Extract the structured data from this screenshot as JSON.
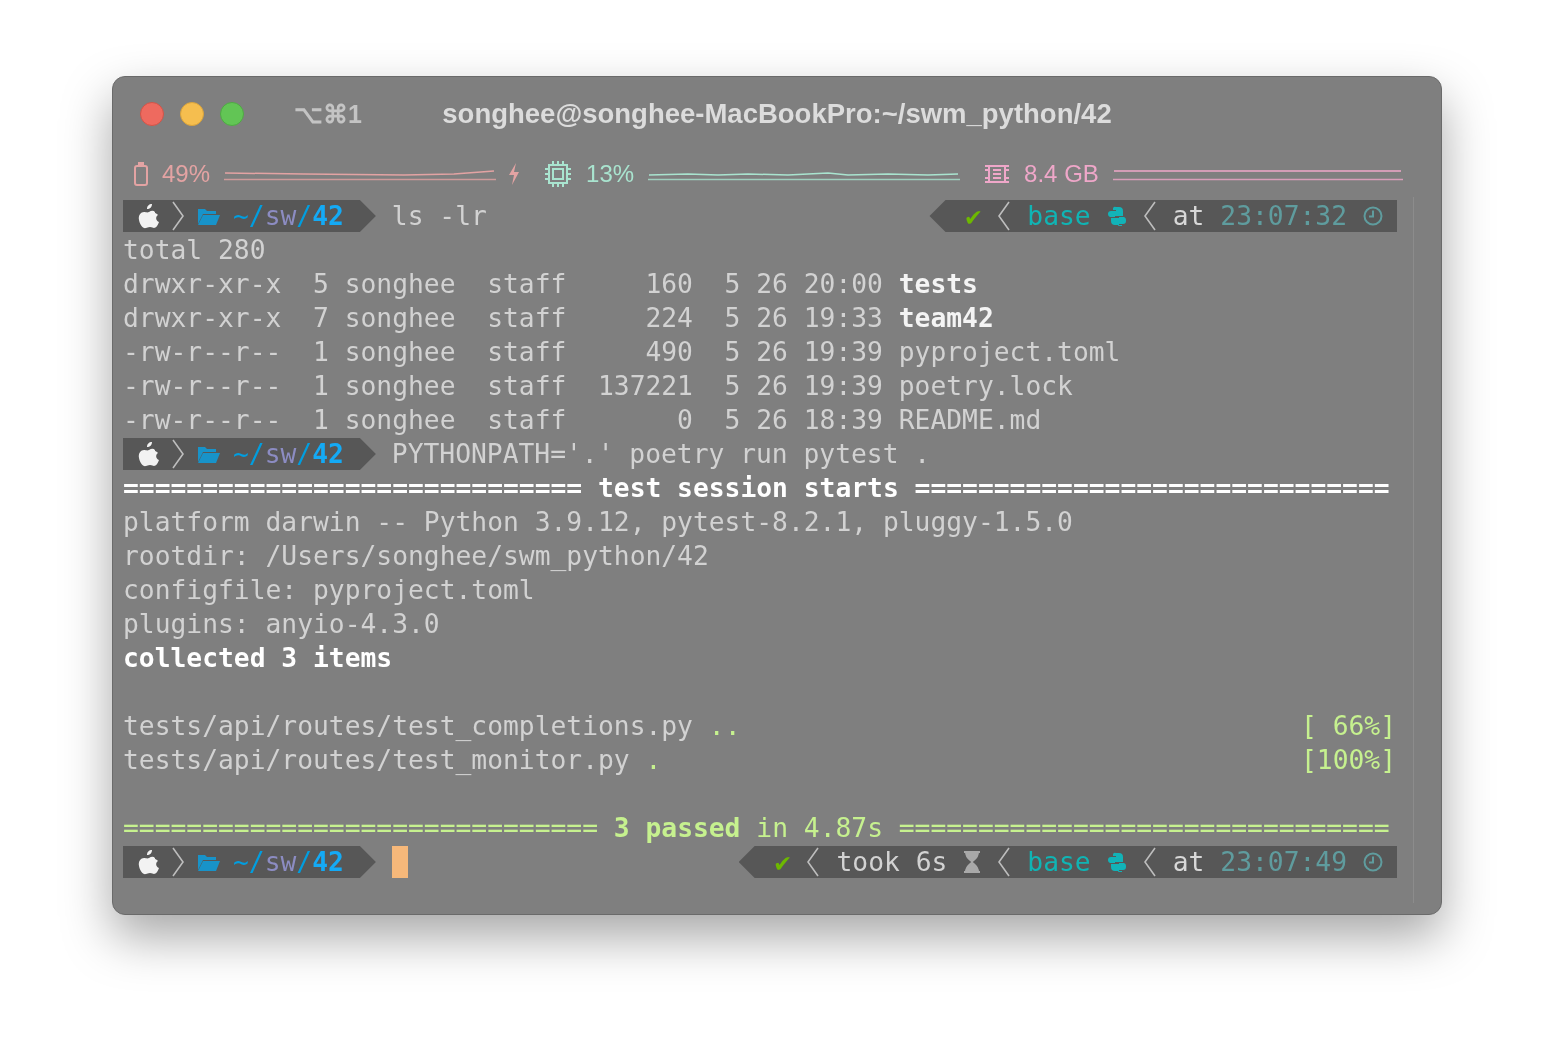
{
  "window": {
    "shortcut": "⌥⌘1",
    "title": "songhee@songhee-MacBookPro:~/swm_python/42"
  },
  "status_bar": [
    {
      "kind": "battery",
      "value": "49%",
      "color": "#e3a3a3"
    },
    {
      "kind": "cpu",
      "value": "13%",
      "color": "#a9e4cf"
    },
    {
      "kind": "memory",
      "value": "8.4 GB",
      "color": "#efa7c9"
    }
  ],
  "lines": [
    {
      "kind": "prompt",
      "path": [
        {
          "text": "~/",
          "kind": "home"
        },
        {
          "text": "sw",
          "kind": "dir"
        },
        {
          "text": "/",
          "kind": "sep"
        },
        {
          "text": "42",
          "kind": "current"
        }
      ],
      "command": "ls -lr",
      "right": [
        {
          "kind": "status",
          "text": "✔"
        },
        {
          "kind": "env",
          "text": "base"
        },
        {
          "kind": "time",
          "label": "at",
          "text": "23:07:32"
        }
      ]
    },
    {
      "kind": "output",
      "segments": [
        {
          "text": "total 280",
          "kind": "plain"
        }
      ]
    },
    {
      "kind": "output",
      "segments": [
        {
          "text": "drwxr-xr-x  5 songhee  staff     160  5 26 20:00 ",
          "kind": "plain"
        },
        {
          "text": "tests",
          "kind": "dir"
        }
      ]
    },
    {
      "kind": "output",
      "segments": [
        {
          "text": "drwxr-xr-x  7 songhee  staff     224  5 26 19:33 ",
          "kind": "plain"
        },
        {
          "text": "team42",
          "kind": "dir"
        }
      ]
    },
    {
      "kind": "output",
      "segments": [
        {
          "text": "-rw-r--r--  1 songhee  staff     490  5 26 19:39 pyproject.toml",
          "kind": "plain"
        }
      ]
    },
    {
      "kind": "output",
      "segments": [
        {
          "text": "-rw-r--r--  1 songhee  staff  137221  5 26 19:39 poetry.lock",
          "kind": "plain"
        }
      ]
    },
    {
      "kind": "output",
      "segments": [
        {
          "text": "-rw-r--r--  1 songhee  staff       0  5 26 18:39 README.md",
          "kind": "plain"
        }
      ]
    },
    {
      "kind": "prompt",
      "path": [
        {
          "text": "~/",
          "kind": "home"
        },
        {
          "text": "sw",
          "kind": "dir"
        },
        {
          "text": "/",
          "kind": "sep"
        },
        {
          "text": "42",
          "kind": "current"
        }
      ],
      "command": "PYTHONPATH='.' poetry run pytest ."
    },
    {
      "kind": "output",
      "segments": [
        {
          "text": "============================= test session starts ==============================",
          "kind": "bold"
        }
      ]
    },
    {
      "kind": "output",
      "segments": [
        {
          "text": "platform darwin -- Python 3.9.12, pytest-8.2.1, pluggy-1.5.0",
          "kind": "plain"
        }
      ]
    },
    {
      "kind": "output",
      "segments": [
        {
          "text": "rootdir: /Users/songhee/swm_python/42",
          "kind": "plain"
        }
      ]
    },
    {
      "kind": "output",
      "segments": [
        {
          "text": "configfile: pyproject.toml",
          "kind": "plain"
        }
      ]
    },
    {
      "kind": "output",
      "segments": [
        {
          "text": "plugins: anyio-4.3.0",
          "kind": "plain"
        }
      ]
    },
    {
      "kind": "output",
      "segments": [
        {
          "text": "collected 3 items",
          "kind": "bold"
        }
      ]
    },
    {
      "kind": "blank"
    },
    {
      "kind": "output",
      "segments": [
        {
          "text": "tests/api/routes/test_completions.py ",
          "kind": "plain"
        },
        {
          "text": "..",
          "kind": "pass"
        }
      ],
      "right": "[ 66%]"
    },
    {
      "kind": "output",
      "segments": [
        {
          "text": "tests/api/routes/test_monitor.py ",
          "kind": "plain"
        },
        {
          "text": ".",
          "kind": "pass"
        }
      ],
      "right": "[100%]"
    },
    {
      "kind": "blank"
    },
    {
      "kind": "output",
      "segments": [
        {
          "text": "============================== ",
          "kind": "pass"
        },
        {
          "text": "3 passed",
          "kind": "pass_bold"
        },
        {
          "text": " in 4.87s ===============================",
          "kind": "pass"
        }
      ]
    },
    {
      "kind": "prompt",
      "path": [
        {
          "text": "~/",
          "kind": "home"
        },
        {
          "text": "sw",
          "kind": "dir"
        },
        {
          "text": "/",
          "kind": "sep"
        },
        {
          "text": "42",
          "kind": "current"
        }
      ],
      "cursor": true,
      "right": [
        {
          "kind": "status",
          "text": "✔"
        },
        {
          "kind": "duration",
          "label": "took",
          "text": "6s"
        },
        {
          "kind": "env",
          "text": "base"
        },
        {
          "kind": "time",
          "label": "at",
          "text": "23:07:49"
        }
      ]
    }
  ]
}
